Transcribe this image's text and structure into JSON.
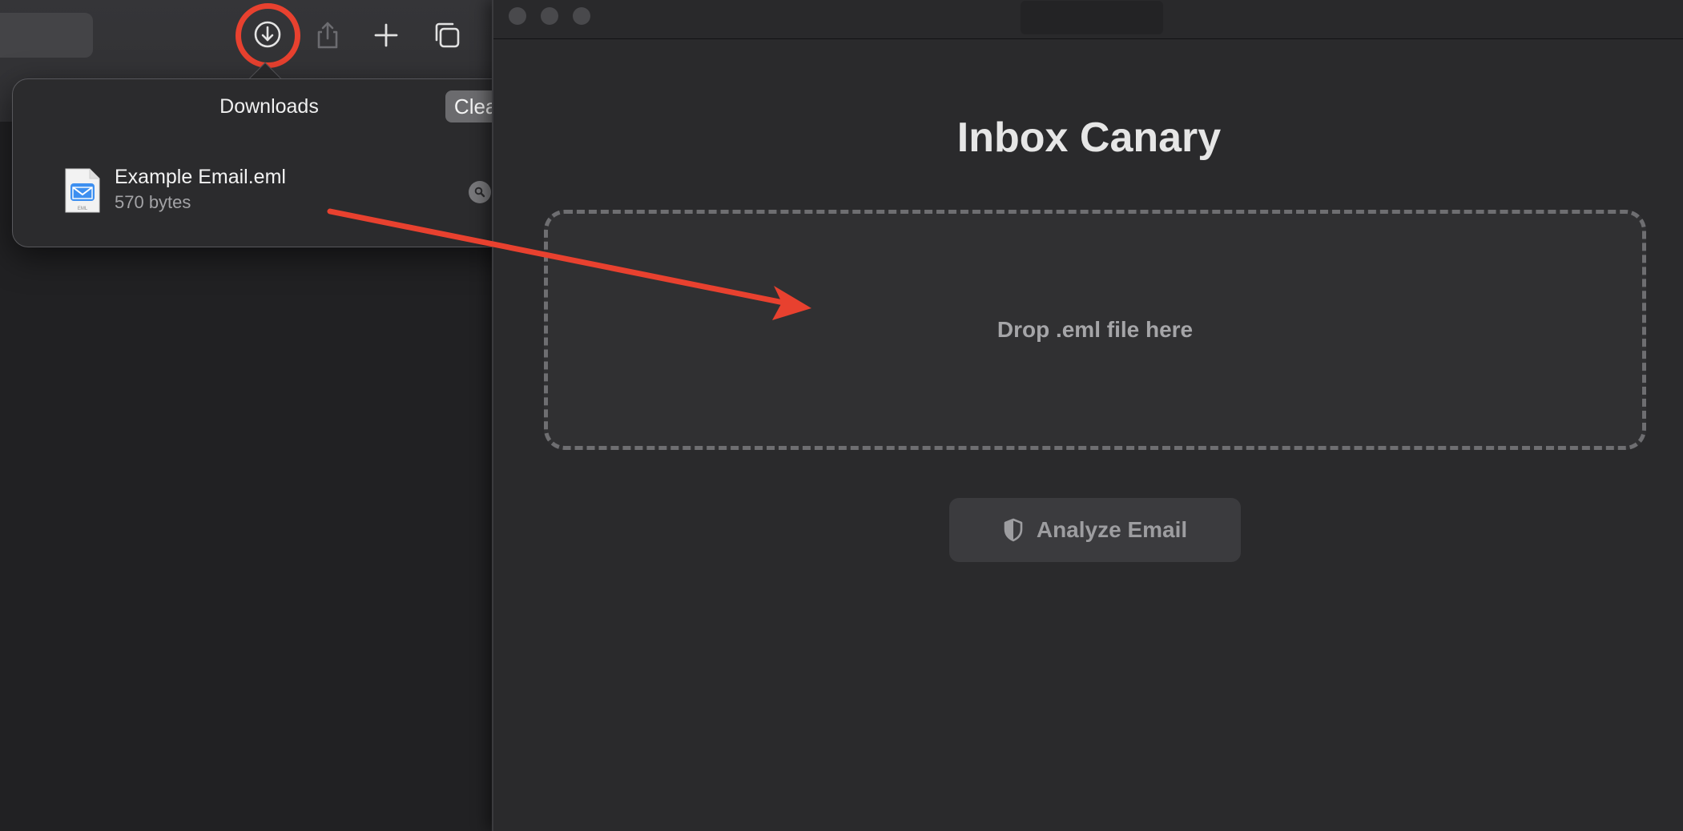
{
  "browser": {
    "toolbar": {
      "download_icon": "download-circle-icon",
      "share_icon": "share-icon",
      "newtab_icon": "plus-icon",
      "tabs_icon": "tab-overview-icon"
    },
    "downloads": {
      "title": "Downloads",
      "clear_label": "Clear",
      "items": [
        {
          "name": "Example Email.eml",
          "size": "570 bytes",
          "icon": "eml-file-icon"
        }
      ]
    }
  },
  "app": {
    "title": "Inbox Canary",
    "dropzone_label": "Drop .eml file here",
    "analyze_label": "Analyze Email"
  },
  "colors": {
    "highlight": "#e8412f",
    "background": "#2a2a2c"
  }
}
